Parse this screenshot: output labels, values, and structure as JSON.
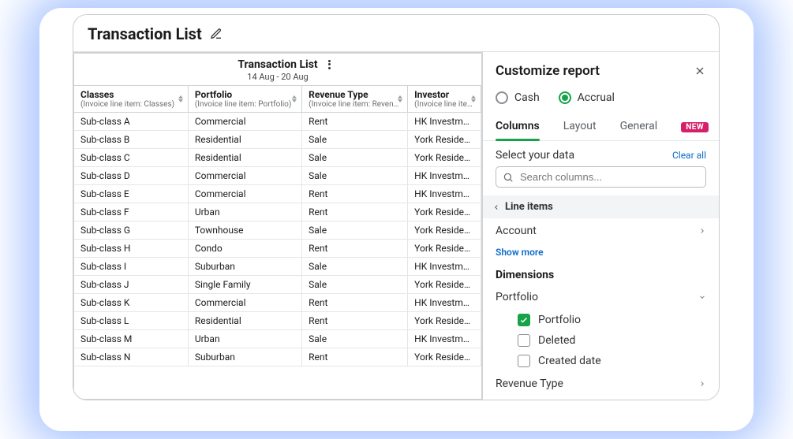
{
  "page": {
    "title": "Transaction List"
  },
  "table": {
    "title": "Transaction List",
    "date_range": "14 Aug - 20 Aug",
    "columns": [
      {
        "label": "Classes",
        "sub": "(Invoice line item: Classes)"
      },
      {
        "label": "Portfolio",
        "sub": "(Invoice line item: Portfolio)"
      },
      {
        "label": "Revenue Type",
        "sub": "(Invoice line item: Revenu...)"
      },
      {
        "label": "Investor",
        "sub": "(Invoice line item:"
      }
    ],
    "rows": [
      {
        "class": "Sub-class A",
        "portfolio": "Commercial",
        "revenue": "Rent",
        "investor": "HK Investment"
      },
      {
        "class": "Sub-class B",
        "portfolio": "Residential",
        "revenue": "Sale",
        "investor": "York Residence"
      },
      {
        "class": "Sub-class C",
        "portfolio": "Residential",
        "revenue": "Sale",
        "investor": "York Residence"
      },
      {
        "class": "Sub-class D",
        "portfolio": "Commercial",
        "revenue": "Sale",
        "investor": "HK Investment"
      },
      {
        "class": "Sub-class E",
        "portfolio": "Commercial",
        "revenue": "Rent",
        "investor": "HK Investment"
      },
      {
        "class": "Sub-class F",
        "portfolio": "Urban",
        "revenue": "Rent",
        "investor": "York Residence"
      },
      {
        "class": "Sub-class G",
        "portfolio": "Townhouse",
        "revenue": "Sale",
        "investor": "York Residence"
      },
      {
        "class": "Sub-class H",
        "portfolio": "Condo",
        "revenue": "Rent",
        "investor": "York Residence"
      },
      {
        "class": "Sub-class I",
        "portfolio": "Suburban",
        "revenue": "Sale",
        "investor": "HK Investment"
      },
      {
        "class": "Sub-class J",
        "portfolio": "Single Family",
        "revenue": "Sale",
        "investor": "York Residence"
      },
      {
        "class": "Sub-class K",
        "portfolio": "Commercial",
        "revenue": "Rent",
        "investor": "HK Investment"
      },
      {
        "class": "Sub-class L",
        "portfolio": "Residential",
        "revenue": "Rent",
        "investor": "York Residence"
      },
      {
        "class": "Sub-class M",
        "portfolio": "Urban",
        "revenue": "Sale",
        "investor": "HK Investment"
      },
      {
        "class": "Sub-class N",
        "portfolio": "Suburban",
        "revenue": "Rent",
        "investor": "York Residence"
      }
    ]
  },
  "customize": {
    "title": "Customize report",
    "basis": {
      "cash_label": "Cash",
      "accrual_label": "Accrual",
      "selected": "accrual"
    },
    "tabs": {
      "columns": "Columns",
      "layout": "Layout",
      "general": "General",
      "new_badge": "NEW",
      "active": "columns"
    },
    "select_label": "Select your data",
    "clear_all": "Clear all",
    "search_placeholder": "Search columns...",
    "line_items": {
      "header": "Line items",
      "account": "Account",
      "show_more": "Show more",
      "dimensions_header": "Dimensions",
      "portfolio_group": "Portfolio",
      "portfolio_opts": {
        "portfolio": {
          "label": "Portfolio",
          "checked": true
        },
        "deleted": {
          "label": "Deleted",
          "checked": false
        },
        "created": {
          "label": "Created date",
          "checked": false
        }
      },
      "revenue_type": "Revenue Type"
    }
  }
}
